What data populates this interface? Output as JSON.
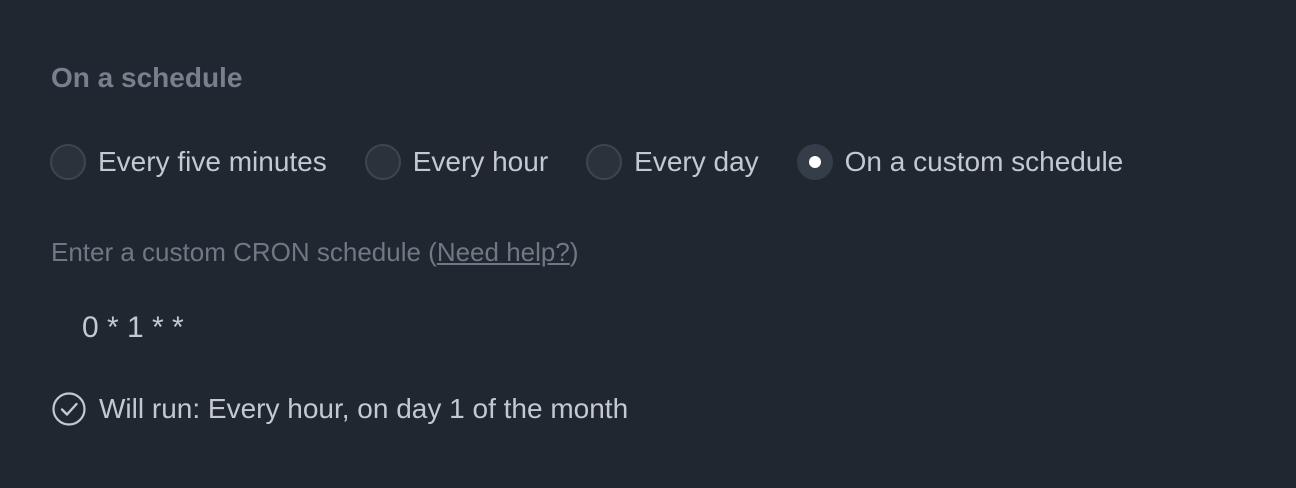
{
  "section": {
    "title": "On a schedule"
  },
  "schedule_options": [
    {
      "label": "Every five minutes",
      "selected": false
    },
    {
      "label": "Every hour",
      "selected": false
    },
    {
      "label": "Every day",
      "selected": false
    },
    {
      "label": "On a custom schedule",
      "selected": true
    }
  ],
  "cron": {
    "label_prefix": "Enter a custom CRON schedule (",
    "help_link": "Need help?",
    "label_suffix": ")",
    "value": "0 * 1 * *"
  },
  "summary": {
    "icon": "check-circle-icon",
    "text": "Will run: Every hour, on day 1 of the month"
  },
  "colors": {
    "background": "#212730",
    "text": "#c3c9d1",
    "muted": "#6f7883",
    "radio_selected_dot": "#ffffff"
  }
}
